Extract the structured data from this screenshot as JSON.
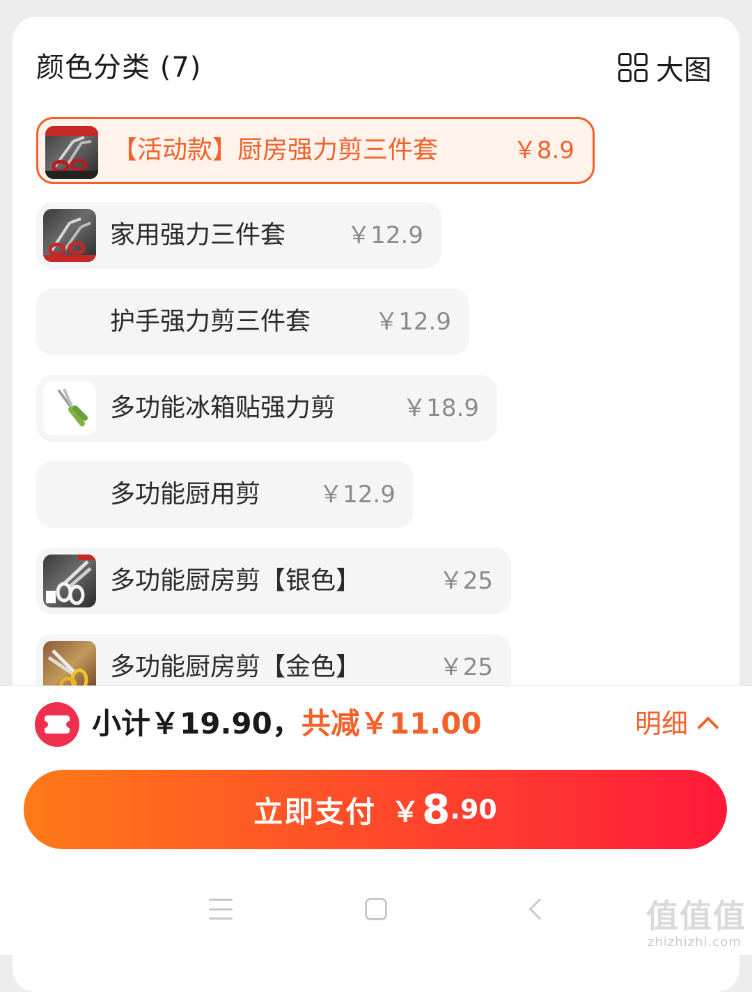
{
  "header": {
    "title": "颜色分类 (7)",
    "big_view_label": "大图"
  },
  "options": [
    {
      "label": "【活动款】厨房强力剪三件套",
      "price": "￥8.9",
      "selected": true,
      "thumb": "dark"
    },
    {
      "label": "家用强力三件套",
      "price": "￥12.9",
      "selected": false,
      "thumb": "dark"
    },
    {
      "label": "护手强力剪三件套",
      "price": "￥12.9",
      "selected": false,
      "thumb": "none"
    },
    {
      "label": "多功能冰箱贴强力剪",
      "price": "￥18.9",
      "selected": false,
      "thumb": "light"
    },
    {
      "label": "多功能厨用剪",
      "price": "￥12.9",
      "selected": false,
      "thumb": "none"
    },
    {
      "label": "多功能厨房剪【银色】",
      "price": "￥25",
      "selected": false,
      "thumb": "dark"
    },
    {
      "label": "多功能厨房剪【金色】",
      "price": "￥25",
      "selected": false,
      "thumb": "gold"
    }
  ],
  "summary": {
    "subtotal": "小计￥19.90，",
    "discount": "共减￥11.00",
    "detail_label": "明细"
  },
  "pay": {
    "label": "立即支付",
    "yen": "￥",
    "amount_int": "8",
    "amount_dec": ".90"
  },
  "watermark": {
    "text": "值值值",
    "url": "zhizhizhi.com"
  },
  "colors": {
    "accent": "#f2612a",
    "coupon_red": "#ee2f4d",
    "pay_gradient_start": "#ff7a18",
    "pay_gradient_end": "#ff1a3a"
  }
}
